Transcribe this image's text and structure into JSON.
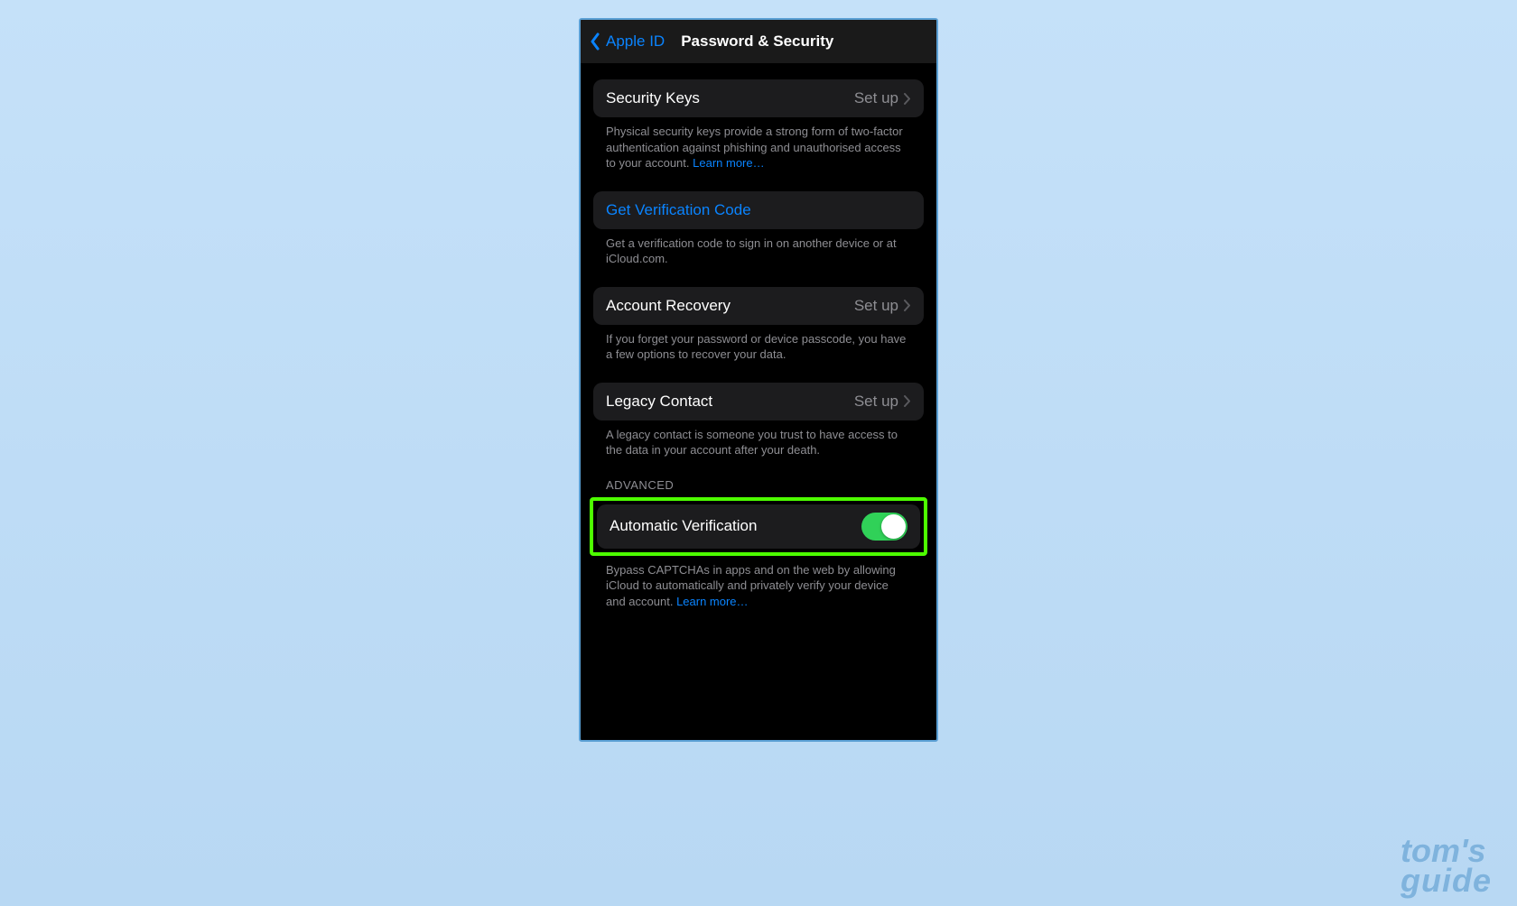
{
  "nav": {
    "back_label": "Apple ID",
    "title": "Password & Security"
  },
  "sections": {
    "security_keys": {
      "title": "Security Keys",
      "action": "Set up",
      "footer": "Physical security keys provide a strong form of two-factor authentication against phishing and unauthorised access to your account. ",
      "link": "Learn more…"
    },
    "verification_code": {
      "title": "Get Verification Code",
      "footer": "Get a verification code to sign in on another device or at iCloud.com."
    },
    "account_recovery": {
      "title": "Account Recovery",
      "action": "Set up",
      "footer": "If you forget your password or device passcode, you have a few options to recover your data."
    },
    "legacy_contact": {
      "title": "Legacy Contact",
      "action": "Set up",
      "footer": "A legacy contact is someone you trust to have access to the data in your account after your death."
    },
    "advanced_header": "ADVANCED",
    "automatic_verification": {
      "title": "Automatic Verification",
      "enabled": true,
      "footer": "Bypass CAPTCHAs in apps and on the web by allowing iCloud to automatically and privately verify your device and account. ",
      "link": "Learn more…"
    }
  },
  "watermark": {
    "line1": "tom's",
    "line2": "guide"
  }
}
